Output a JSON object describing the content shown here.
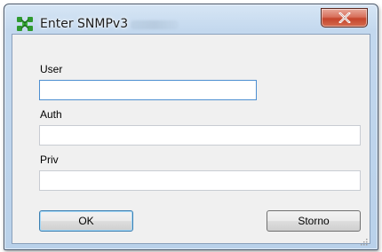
{
  "window": {
    "title": "Enter SNMPv3",
    "icon": "green-network-icon",
    "close_icon": "close-icon"
  },
  "form": {
    "user_label": "User",
    "user_value": "",
    "auth_label": "Auth",
    "auth_value": "",
    "priv_label": "Priv",
    "priv_value": ""
  },
  "buttons": {
    "ok_label": "OK",
    "cancel_label": "Storno"
  },
  "colors": {
    "close_button": "#c5452c",
    "focus_border": "#4d8fd1",
    "icon_green": "#2f9a2f"
  }
}
